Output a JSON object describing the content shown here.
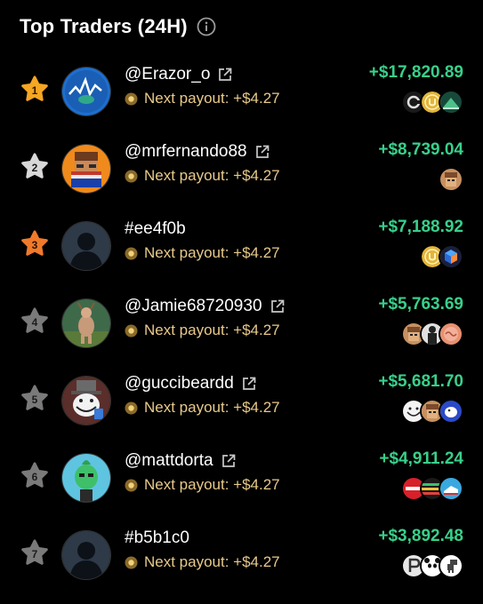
{
  "header": {
    "title": "Top Traders (24H)",
    "info_icon": "info-circle-icon"
  },
  "colors": {
    "background": "#000000",
    "gain": "#38d08a",
    "payout": "#e8c98a",
    "rank_gold": "#f5a623",
    "rank_silver": "#cfcfcf",
    "rank_bronze": "#f07a2a",
    "rank_default": "#6e6e6e"
  },
  "traders": [
    {
      "rank": "1",
      "rank_style": "gold",
      "name": "@Erazor_o",
      "external_link": true,
      "payout": "Next payout: +$4.27",
      "amount": "+$17,820.89",
      "avatar": "blue-chart-avatar",
      "tokens": [
        "dark-c-token",
        "gold-coin-token",
        "green-mountain-token"
      ]
    },
    {
      "rank": "2",
      "rank_style": "silver",
      "name": "@mrfernando88",
      "external_link": true,
      "payout": "Next payout: +$4.27",
      "amount": "+$8,739.04",
      "avatar": "pixel-punk-avatar",
      "tokens": [
        "tan-face-token"
      ]
    },
    {
      "rank": "3",
      "rank_style": "bronze",
      "name": "#ee4f0b",
      "external_link": false,
      "payout": "Next payout: +$4.27",
      "amount": "+$7,188.92",
      "avatar": "default-silhouette-avatar",
      "tokens": [
        "gold-coin-token",
        "blue-cube-token"
      ]
    },
    {
      "rank": "4",
      "rank_style": "default",
      "name": "@Jamie68720930",
      "external_link": true,
      "payout": "Next payout: +$4.27",
      "amount": "+$5,763.69",
      "avatar": "deer-figure-avatar",
      "tokens": [
        "tan-face-token",
        "suit-figure-token",
        "pink-brain-token"
      ]
    },
    {
      "rank": "5",
      "rank_style": "default",
      "name": "@guccibeardd",
      "external_link": true,
      "payout": "Next payout: +$4.27",
      "amount": "+$5,681.70",
      "avatar": "trollface-hat-avatar",
      "tokens": [
        "trollface-token",
        "tan-face-token",
        "blue-bird-token"
      ]
    },
    {
      "rank": "6",
      "rank_style": "default",
      "name": "@mattdorta",
      "external_link": true,
      "payout": "Next payout: +$4.27",
      "amount": "+$4,911.24",
      "avatar": "green-pepe-avatar",
      "tokens": [
        "amc-red-token",
        "stripes-token",
        "sneaker-token"
      ]
    },
    {
      "rank": "7",
      "rank_style": "default",
      "name": "#b5b1c0",
      "external_link": false,
      "payout": "Next payout: +$4.27",
      "amount": "+$3,892.48",
      "avatar": "default-silhouette-avatar",
      "tokens": [
        "white-p-token",
        "panda-token",
        "dino-token"
      ]
    }
  ]
}
